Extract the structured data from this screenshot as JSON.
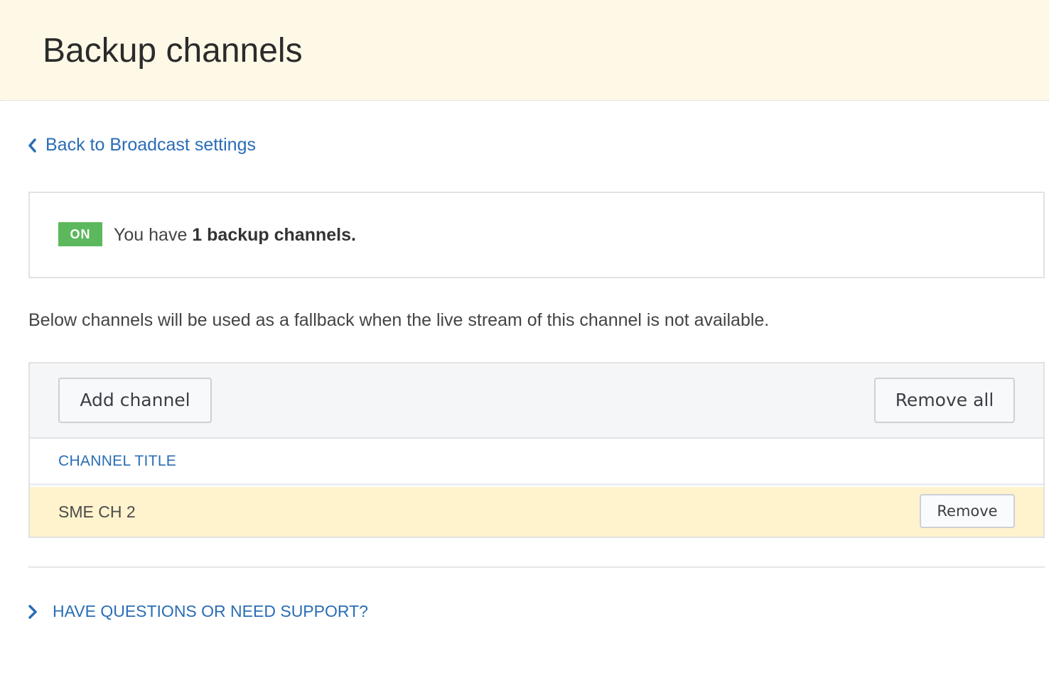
{
  "header": {
    "title": "Backup channels"
  },
  "back_link": {
    "label": "Back to Broadcast settings",
    "icon": "chevron-left-icon"
  },
  "status": {
    "badge": "ON",
    "badge_color": "#5cb85c",
    "text_prefix": "You have ",
    "text_bold": "1 backup channels."
  },
  "description": "Below channels will be used as a fallback when the live stream of this channel is not available.",
  "toolbar": {
    "add_label": "Add channel",
    "remove_all_label": "Remove all"
  },
  "table": {
    "column_header": "CHANNEL TITLE",
    "rows": [
      {
        "title": "SME CH 2",
        "action_label": "Remove"
      }
    ]
  },
  "support": {
    "label": "HAVE QUESTIONS OR NEED SUPPORT?",
    "icon": "chevron-right-icon"
  },
  "colors": {
    "header_bg": "#fef9e7",
    "link": "#2a6db5",
    "row_highlight": "#fef3cd"
  }
}
